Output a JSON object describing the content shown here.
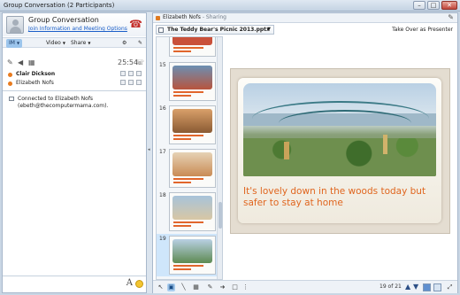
{
  "window": {
    "title": "Group Conversation (2 Participants)"
  },
  "conversation": {
    "title": "Group Conversation",
    "join_link": "Join Information and Meeting Options",
    "tabs": [
      {
        "label": "IM"
      },
      {
        "label": "Video"
      },
      {
        "label": "Share"
      }
    ],
    "call_time": "25:54",
    "participants": [
      {
        "name": "Clair Dickson",
        "bold": true
      },
      {
        "name": "Elizabeth Nofs",
        "bold": false
      }
    ],
    "messages": [
      {
        "line1": "Connected to Elizabeth Nofs",
        "line2": "(ebeth@thecomputermama.com)."
      }
    ],
    "input_placeholder": "",
    "font_button": "A"
  },
  "sharing": {
    "presenter": "Elizabeth Nofs",
    "status": " - Sharing",
    "file_name": "The Teddy Bear's Picnic 2013.pptx",
    "take_over": "Take Over as Presenter"
  },
  "thumbnails": [
    {
      "number": "",
      "pic_color": "#c9503a"
    },
    {
      "number": "15",
      "pic_color": "#b8543d"
    },
    {
      "number": "16",
      "pic_color": "#8a5a33"
    },
    {
      "number": "17",
      "pic_color": "#c98b55"
    },
    {
      "number": "18",
      "pic_color": "#6d8fa7"
    },
    {
      "number": "19",
      "pic_color": "#5d8a52",
      "selected": true
    }
  ],
  "slide": {
    "caption": "It's lovely down in the woods today but safer to stay at home"
  },
  "pager": {
    "text": "19 of 21"
  },
  "colors": {
    "accent": "#e0661f",
    "selection": "#cfe6fb",
    "link": "#1a5ec8"
  }
}
